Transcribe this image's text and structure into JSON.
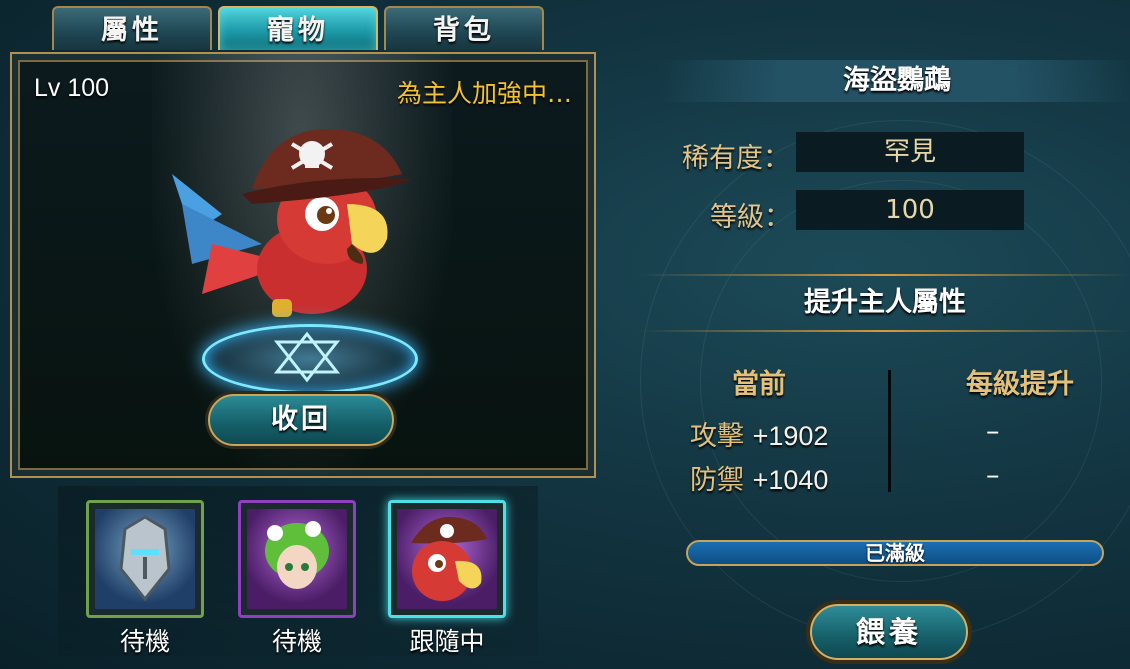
{
  "tabs": [
    {
      "label": "屬性",
      "active": false
    },
    {
      "label": "寵物",
      "active": true
    },
    {
      "label": "背包",
      "active": false
    }
  ],
  "pet_display": {
    "level_text": "Lv 100",
    "status_text": "為主人加強中…",
    "recall_label": "收回"
  },
  "slots": [
    {
      "label": "待機",
      "icon": "armored-knight-pet",
      "border": "#6fa14a",
      "active": false
    },
    {
      "label": "待機",
      "icon": "leaf-fairy-pet",
      "border": "#8f3fbf",
      "active": false
    },
    {
      "label": "跟隨中",
      "icon": "pirate-parrot-pet",
      "border": "#8f3fbf",
      "active": true
    }
  ],
  "info": {
    "name": "海盜鸚鵡",
    "rarity_label": "稀有度：",
    "rarity_value": "罕見",
    "level_label": "等級：",
    "level_value": "100",
    "section_title": "提升主人屬性",
    "col_current": "當前",
    "col_per_level": "每級提升",
    "stats": [
      {
        "name": "攻擊",
        "value": "+1902",
        "per_level": "–"
      },
      {
        "name": "防禦",
        "value": "+1040",
        "per_level": "–"
      }
    ],
    "max_level_text": "已滿級",
    "feed_label": "餵養"
  },
  "colors": {
    "accent_gold": "#e3c17a",
    "status_yellow": "#f2c232",
    "active_tab": "#1d9aa8",
    "maxbar_blue": "#1a6fb0"
  }
}
